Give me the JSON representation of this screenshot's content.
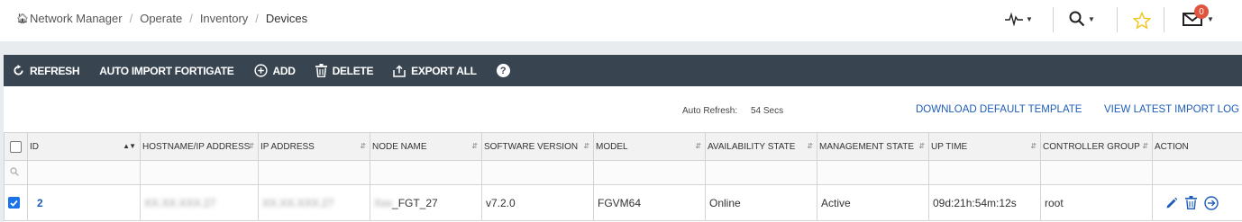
{
  "breadcrumb": {
    "items": [
      "Network Manager",
      "Operate",
      "Inventory",
      "Devices"
    ]
  },
  "top_icons": {
    "notification_count": "0"
  },
  "toolbar": {
    "refresh": "REFRESH",
    "auto_import": "AUTO IMPORT FORTIGATE",
    "add": "ADD",
    "delete": "DELETE",
    "export_all": "EXPORT ALL",
    "help": "?"
  },
  "auto_refresh": {
    "label": "Auto Refresh:",
    "value": "54 Secs"
  },
  "links": {
    "download_template": "DOWNLOAD DEFAULT TEMPLATE",
    "view_import_log": "VIEW LATEST IMPORT LOG"
  },
  "table": {
    "columns": [
      "ID",
      "HOSTNAME/IP ADDRESS",
      "IP ADDRESS",
      "NODE NAME",
      "SOFTWARE VERSION",
      "MODEL",
      "AVAILABILITY STATE",
      "MANAGEMENT STATE",
      "UP TIME",
      "CONTROLLER GROUP",
      "ACTION"
    ],
    "rows": [
      {
        "id": "2",
        "hostname": "XX.XX.XXX.27",
        "ip": "XX.XX.XXX.27",
        "node_prefix": "Xxx",
        "node_suffix": "_FGT_27",
        "software_version": "v7.2.0",
        "model": "FGVM64",
        "availability": "Online",
        "management": "Active",
        "uptime": "09d:21h:54m:12s",
        "controller_group": "root",
        "selected": true
      }
    ]
  },
  "colors": {
    "toolbar_bg": "#384551",
    "link": "#1d5db8",
    "badge": "#e0533c",
    "checkbox": "#1a73e8",
    "star": "#f0c419"
  }
}
